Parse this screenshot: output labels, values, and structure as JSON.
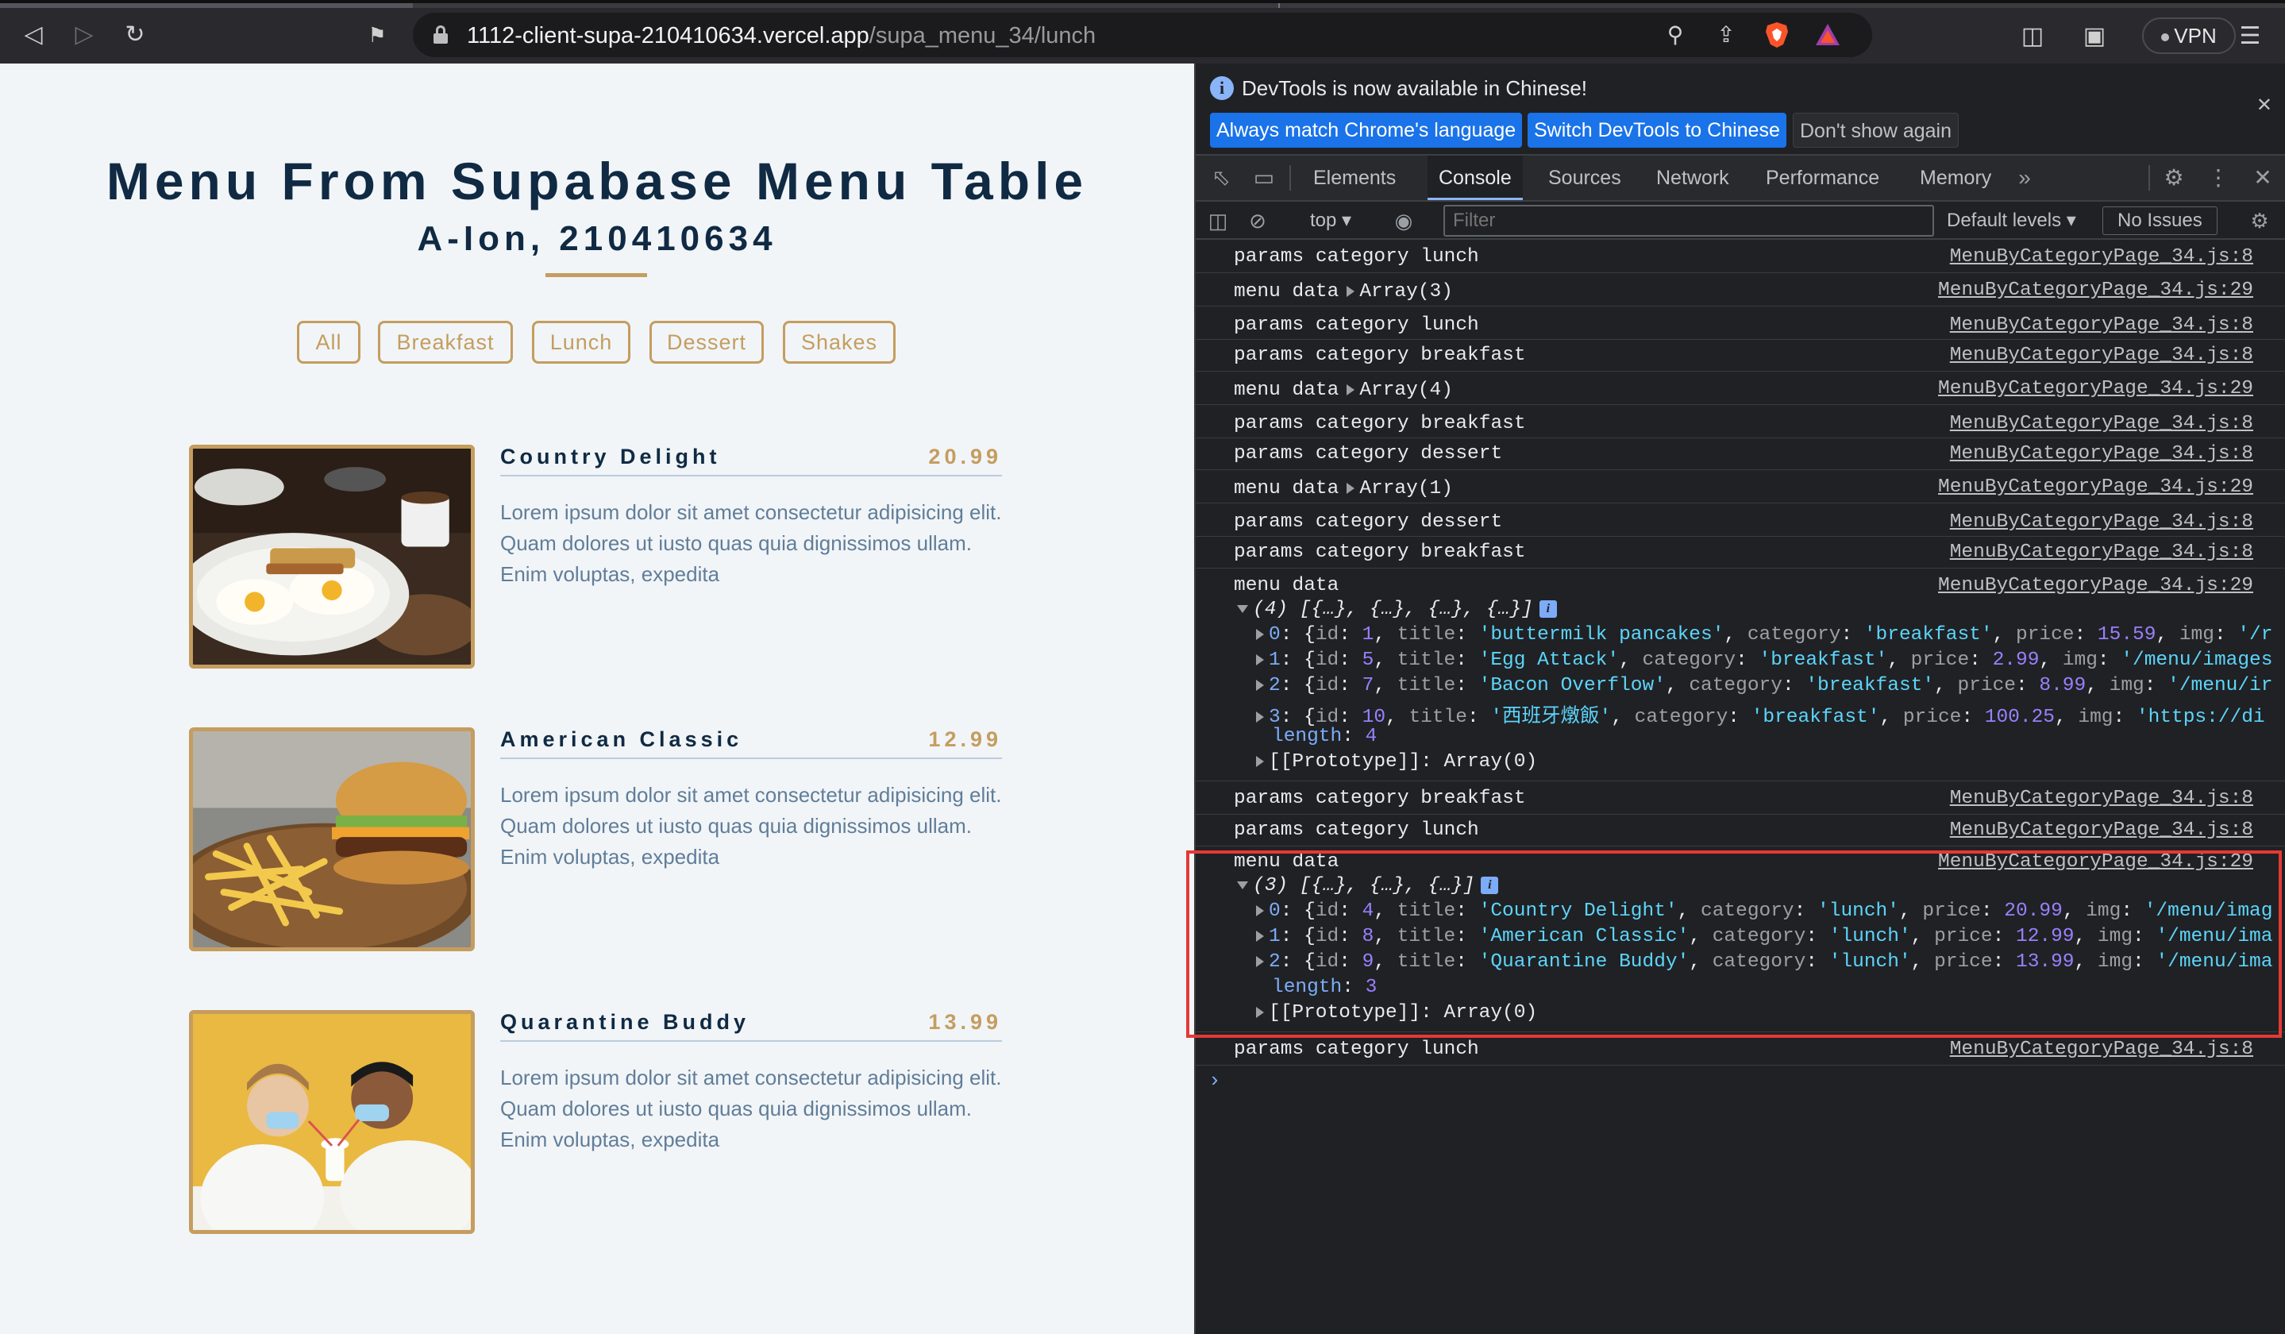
{
  "browser": {
    "url_host": "1112-client-supa-210410634.vercel.app",
    "url_path": "/supa_menu_34/lunch",
    "vpn_label": "VPN"
  },
  "page": {
    "title": "Menu From Supabase Menu Table",
    "subtitle": "A-Ion, 210410634",
    "filters": [
      "All",
      "Breakfast",
      "Lunch",
      "Dessert",
      "Shakes"
    ],
    "items": [
      {
        "title": "Country Delight",
        "price": "20.99",
        "desc": "Lorem ipsum dolor sit amet consectetur adipisicing elit. Quam dolores ut iusto quas quia dignissimos ullam. Enim voluptas, expedita"
      },
      {
        "title": "American Classic",
        "price": "12.99",
        "desc": "Lorem ipsum dolor sit amet consectetur adipisicing elit. Quam dolores ut iusto quas quia dignissimos ullam. Enim voluptas, expedita"
      },
      {
        "title": "Quarantine Buddy",
        "price": "13.99",
        "desc": "Lorem ipsum dolor sit amet consectetur adipisicing elit. Quam dolores ut iusto quas quia dignissimos ullam. Enim voluptas, expedita"
      }
    ]
  },
  "devtools": {
    "infobar": {
      "message": "DevTools is now available in Chinese!",
      "btn_match": "Always match Chrome's language",
      "btn_switch": "Switch DevTools to Chinese",
      "btn_dismiss": "Don't show again"
    },
    "tabs": [
      "Elements",
      "Console",
      "Sources",
      "Network",
      "Performance",
      "Memory"
    ],
    "active_tab": "Console",
    "context": "top",
    "filter_placeholder": "Filter",
    "levels": "Default levels",
    "issues": "No Issues",
    "src8": "MenuByCategoryPage_34.js:8",
    "src29": "MenuByCategoryPage_34.js:29",
    "lines": {
      "l1": "params category lunch",
      "l2": "menu data",
      "l2b": "Array(3)",
      "l3": "params category lunch",
      "l4": "params category breakfast",
      "l5": "menu data",
      "l5b": "Array(4)",
      "l6": "params category breakfast",
      "l7": "params category dessert",
      "l8": "menu data",
      "l8b": "Array(1)",
      "l9": "params category dessert",
      "l10": "params category breakfast",
      "l11": "menu data",
      "l11_head": "(4) [{…}, {…}, {…}, {…}]",
      "l12": "params category breakfast",
      "l13": "params category lunch",
      "l14": "menu data",
      "l14_head": "(3) [{…}, {…}, {…}]",
      "l15": "params category lunch"
    },
    "breakfast_rows": [
      {
        "idx": "0",
        "id": "1",
        "title": "'buttermilk pancakes'",
        "category": "'breakfast'",
        "price": "15.59",
        "img": "'/r"
      },
      {
        "idx": "1",
        "id": "5",
        "title": "'Egg Attack'",
        "category": "'breakfast'",
        "price": "2.99",
        "img": "'/menu/images"
      },
      {
        "idx": "2",
        "id": "7",
        "title": "'Bacon Overflow'",
        "category": "'breakfast'",
        "price": "8.99",
        "img": "'/menu/ir"
      },
      {
        "idx": "3",
        "id": "10",
        "title": "'西班牙燉飯'",
        "category": "'breakfast'",
        "price": "100.25",
        "img": "'https://di"
      }
    ],
    "breakfast_length": "4",
    "lunch_rows": [
      {
        "idx": "0",
        "id": "4",
        "title": "'Country Delight'",
        "category": "'lunch'",
        "price": "20.99",
        "img": "'/menu/imag"
      },
      {
        "idx": "1",
        "id": "8",
        "title": "'American Classic'",
        "category": "'lunch'",
        "price": "12.99",
        "img": "'/menu/ima"
      },
      {
        "idx": "2",
        "id": "9",
        "title": "'Quarantine Buddy'",
        "category": "'lunch'",
        "price": "13.99",
        "img": "'/menu/ima"
      }
    ],
    "lunch_length": "3",
    "prototype": "Array(0)"
  }
}
